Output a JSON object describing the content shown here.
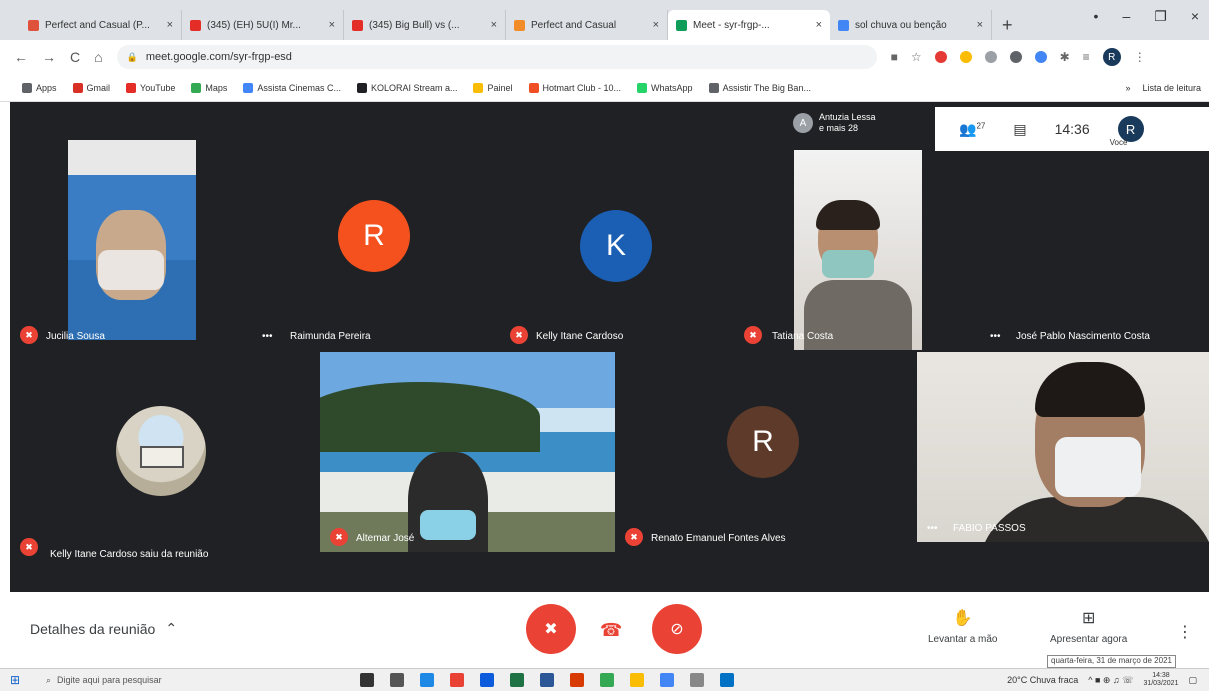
{
  "browser": {
    "tabs": [
      {
        "label": "Perfect and Casual (P...",
        "color": "#e0513c"
      },
      {
        "label": "(345) (EH) 5U(I) Mr...",
        "color": "#e52d27"
      },
      {
        "label": "(345) Big Bull) vs (...",
        "color": "#e52d27"
      },
      {
        "label": "Perfect and Casual",
        "color": "#f28c28"
      },
      {
        "label": "Meet - syr-frgp-...",
        "color": "#0f9d58"
      },
      {
        "label": "sol chuva ou benção",
        "color": "#4285f4"
      }
    ],
    "tab_close": "×",
    "new_tab": "+",
    "window_controls": [
      "•",
      "–",
      "❐",
      "×"
    ],
    "nav": {
      "back": "←",
      "forward": "→",
      "reload": "C",
      "home": "⌂",
      "lock": "🔒"
    },
    "url": "meet.google.com/syr-frgp-esd",
    "profile_initial": "R",
    "bookmarks": [
      {
        "label": "Apps",
        "color": "#5f6368"
      },
      {
        "label": "Gmail",
        "color": "#d93025"
      },
      {
        "label": "YouTube",
        "color": "#e52d27"
      },
      {
        "label": "Maps",
        "color": "#34a853"
      },
      {
        "label": "Assista Cinemas C...",
        "color": "#4285f4"
      },
      {
        "label": "KOLORAI Stream a...",
        "color": "#202124"
      },
      {
        "label": "Painel",
        "color": "#fbbc04"
      },
      {
        "label": "Hotmart Club - 10...",
        "color": "#f04e23"
      },
      {
        "label": "WhatsApp",
        "color": "#25d366"
      },
      {
        "label": "Assistir The Big Ban...",
        "color": "#5f6368"
      }
    ],
    "bookmarks_overflow": "»",
    "reading_list": "Lista de leitura"
  },
  "meet": {
    "presenter": {
      "initial": "A",
      "line1": "Antuzia Lessa",
      "line2": "e mais 28"
    },
    "participants_count": "27",
    "clock": "14:36",
    "me": {
      "initial": "R",
      "label": "Você"
    },
    "tiles": [
      {
        "name": "Jucilia Sousa"
      },
      {
        "name": "Raimunda Pereira",
        "initial": "R",
        "color": "#f4511e"
      },
      {
        "name": "Kelly Itane Cardoso",
        "initial": "K",
        "color": "#1a5fb4"
      },
      {
        "name": "Tatiana Costa"
      },
      {
        "name": "José Pablo Nascimento Costa"
      },
      {
        "name": "Kelly Itane Cardoso saiu da reunião"
      },
      {
        "name": "Altemar José"
      },
      {
        "name": "Renato Emanuel Fontes Alves",
        "initial": "R",
        "color": "#5d3a2a"
      },
      {
        "name": "FABIO PASSOS"
      }
    ],
    "details_label": "Detalhes da reunião",
    "details_chevron": "⌃",
    "mic_icon": "✖",
    "cam_icon": "⊘",
    "hangup_icon": "☎",
    "raise_hand": "Levantar a mão",
    "raise_hand_icon": "✋",
    "present_now": "Apresentar agora",
    "present_icon": "⊞",
    "more_icon": "⋮",
    "tooltip": "quarta-feira, 31 de março de 2021"
  },
  "taskbar": {
    "start": "⊞",
    "search_placeholder": "Digite aqui para pesquisar",
    "app_colors": [
      "#333333",
      "#555555",
      "#1e88e5",
      "#e94235",
      "#0d5bdd",
      "#1f7244",
      "#2b5797",
      "#d83b01",
      "#34a853",
      "#fbbc04",
      "#4285f4",
      "#888888",
      "#0072c6"
    ],
    "weather": "20°C Chuva fraca",
    "tray_icons": "^ ■ ⊕ ♫ ☏",
    "time": "14:38",
    "date": "31/03/2021",
    "notification": "▢"
  }
}
